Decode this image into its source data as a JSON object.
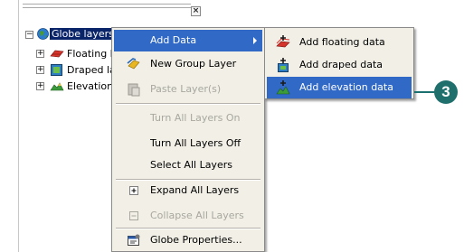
{
  "toc": {
    "close_glyph": "×",
    "root_label": "Globe layers",
    "layers": [
      {
        "label": "Floating la",
        "icon": "floating-layer-icon"
      },
      {
        "label": "Draped la",
        "icon": "draped-layer-icon"
      },
      {
        "label": "Elevation",
        "icon": "elevation-layer-icon"
      }
    ],
    "expand_glyph_root": "−",
    "expand_glyph": "+"
  },
  "context_menu": {
    "items": [
      {
        "label": "Add Data",
        "icon": "",
        "state": "highlighted",
        "submenu": true
      },
      {
        "label": "New Group Layer",
        "icon": "group-layer-icon",
        "state": "enabled"
      },
      {
        "label": "Paste Layer(s)",
        "icon": "paste-icon",
        "state": "disabled"
      },
      {
        "label": "Turn All Layers On",
        "icon": "",
        "state": "disabled"
      },
      {
        "label": "Turn All Layers Off",
        "icon": "",
        "state": "enabled"
      },
      {
        "label": "Select All Layers",
        "icon": "",
        "state": "enabled"
      },
      {
        "label": "Expand All Layers",
        "icon": "expand-icon",
        "state": "enabled"
      },
      {
        "label": "Collapse All Layers",
        "icon": "collapse-icon",
        "state": "disabled"
      },
      {
        "label": "Globe Properties...",
        "icon": "properties-icon",
        "state": "enabled"
      }
    ]
  },
  "submenu": {
    "items": [
      {
        "label": "Add floating data",
        "icon": "add-floating-data-icon",
        "state": "enabled"
      },
      {
        "label": "Add draped data",
        "icon": "add-draped-data-icon",
        "state": "enabled"
      },
      {
        "label": "Add elevation data",
        "icon": "add-elevation-data-icon",
        "state": "highlighted"
      }
    ]
  },
  "callout": {
    "number": "3"
  },
  "colors": {
    "highlight": "#3169c6",
    "menu_bg": "#f1efe6",
    "callout": "#1f6f6c",
    "selection": "#0a246a"
  }
}
